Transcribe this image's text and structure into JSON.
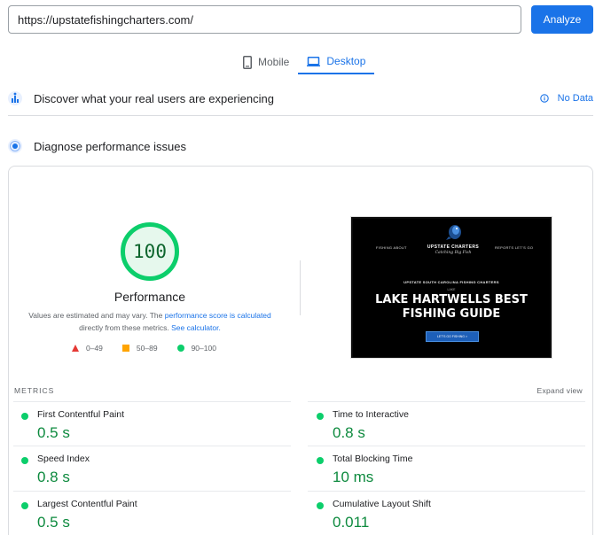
{
  "url_bar": {
    "value": "https://upstatefishingcharters.com/"
  },
  "analyze_label": "Analyze",
  "tabs": [
    {
      "label": "Mobile",
      "icon": "phone-icon",
      "active": false
    },
    {
      "label": "Desktop",
      "icon": "laptop-icon",
      "active": true
    }
  ],
  "sections": {
    "field": {
      "title": "Discover what your real users are experiencing",
      "status": "No Data"
    },
    "lab": {
      "title": "Diagnose performance issues"
    }
  },
  "score": {
    "value": "100",
    "label": "Performance"
  },
  "note": {
    "text1": "Values are estimated and may vary. The ",
    "link1": "performance score is calculated",
    "text2": " directly from these metrics. ",
    "link2": "See calculator."
  },
  "legend": [
    {
      "range": "0–49",
      "shape": "triangle",
      "color": "#e53935"
    },
    {
      "range": "50–89",
      "shape": "square",
      "color": "#ffa400"
    },
    {
      "range": "90–100",
      "shape": "circle",
      "color": "#0cce6b"
    }
  ],
  "screenshot": {
    "nav_left": "FISHING    ABOUT",
    "nav_right": "REPORTS    LET'S GO",
    "brand": "UPSTATE CHARTERS",
    "brand_sub": "Catching Big Fish",
    "kicker": "UPSTATE SOUTH CAROLINA FISHING CHARTERS",
    "small": "LAKE",
    "title": "LAKE HARTWELLS BEST FISHING GUIDE",
    "button": "LET'S GO FISHING >"
  },
  "metrics": {
    "heading": "METRICS",
    "expand": "Expand view",
    "items": [
      {
        "name": "First Contentful Paint",
        "value": "0.5 s"
      },
      {
        "name": "Time to Interactive",
        "value": "0.8 s"
      },
      {
        "name": "Speed Index",
        "value": "0.8 s"
      },
      {
        "name": "Total Blocking Time",
        "value": "10 ms"
      },
      {
        "name": "Largest Contentful Paint",
        "value": "0.5 s"
      },
      {
        "name": "Cumulative Layout Shift",
        "value": "0.011"
      }
    ]
  },
  "colors": {
    "accent": "#1a73e8",
    "pass": "#0cce6b",
    "average": "#ffa400",
    "fail": "#e53935"
  }
}
